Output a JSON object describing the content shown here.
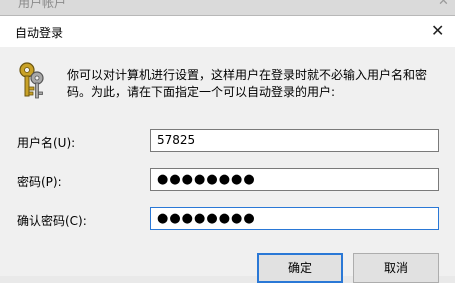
{
  "background_window": {
    "title": "用户帐户",
    "close_icon": "close-icon"
  },
  "dialog": {
    "title": "自动登录",
    "close_icon": "close-icon",
    "icon": "keys-icon",
    "description": "你可以对计算机进行设置，这样用户在登录时就不必输入用户名和密码。为此，请在下面指定一个可以自动登录的用户:",
    "fields": {
      "username": {
        "label": "用户名(U):",
        "value": "57825"
      },
      "password": {
        "label": "密码(P):",
        "value": "●●●●●●●●"
      },
      "confirm_password": {
        "label": "确认密码(C):",
        "value": "●●●●●●●●"
      }
    },
    "buttons": {
      "ok": "确定",
      "cancel": "取消"
    }
  },
  "colors": {
    "accent": "#2a78d6",
    "dialog_bg": "#f0f0f0",
    "titlebar_bg": "#ffffff"
  }
}
